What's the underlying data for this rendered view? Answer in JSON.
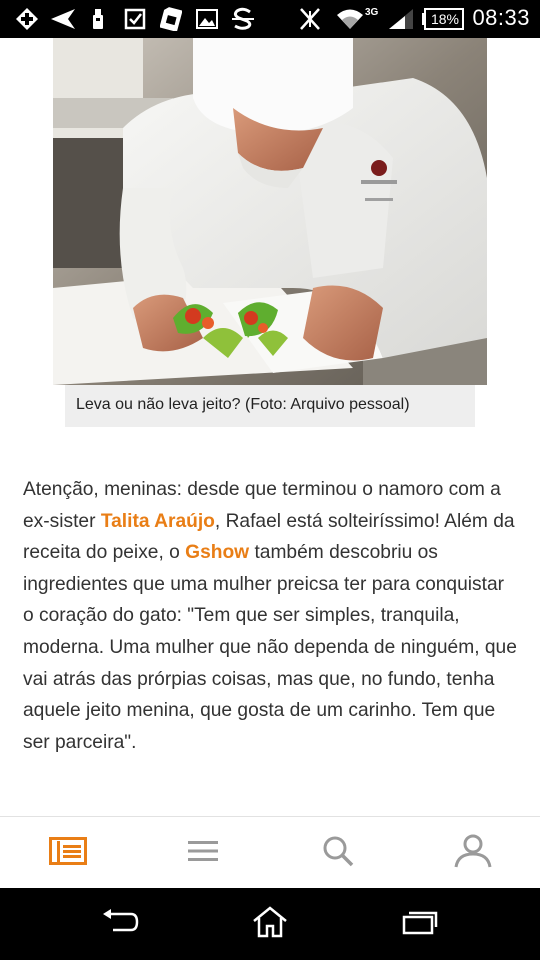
{
  "status_bar": {
    "icons": [
      "add-box-icon",
      "send-icon",
      "usb-icon",
      "checkbox-icon",
      "sim-card-icon",
      "image-icon",
      "s-app-icon",
      "mute-icon",
      "wifi-icon",
      "signal-icon"
    ],
    "network": "3G",
    "battery": "18%",
    "time": "08:33"
  },
  "article": {
    "photo_icon": "chef-plating-photo",
    "caption": "Leva ou não leva jeito? (Foto: Arquivo pessoal)",
    "paragraph": {
      "p1": "Atenção, meninas: desde que terminou o namoro com a ex-sister ",
      "link1": "Talita Araújo",
      "p2": ", Rafael está solteiríssimo! Além da receita do peixe, o ",
      "link2": "Gshow",
      "p3": " também descobriu os ingredientes que uma mulher preicsa ter para conquistar o coração do gato: \"Tem que ser simples, tranquila, moderna. Uma mulher que não dependa de ninguém, que vai atrás das prórpias coisas, mas que, no fundo, tenha aquele jeito menina, que gosta de um carinho. Tem que ser parceira\"."
    },
    "accent_color": "#e97e16"
  },
  "tab_bar": {
    "tabs": [
      {
        "icon": "news-icon",
        "active": true
      },
      {
        "icon": "menu-icon",
        "active": false
      },
      {
        "icon": "search-icon",
        "active": false
      },
      {
        "icon": "profile-icon",
        "active": false
      }
    ],
    "active_color": "#e97e16",
    "inactive_color": "#9a9a9a"
  },
  "nav_bar": {
    "buttons": [
      "back-icon",
      "home-icon",
      "recent-apps-icon"
    ]
  }
}
